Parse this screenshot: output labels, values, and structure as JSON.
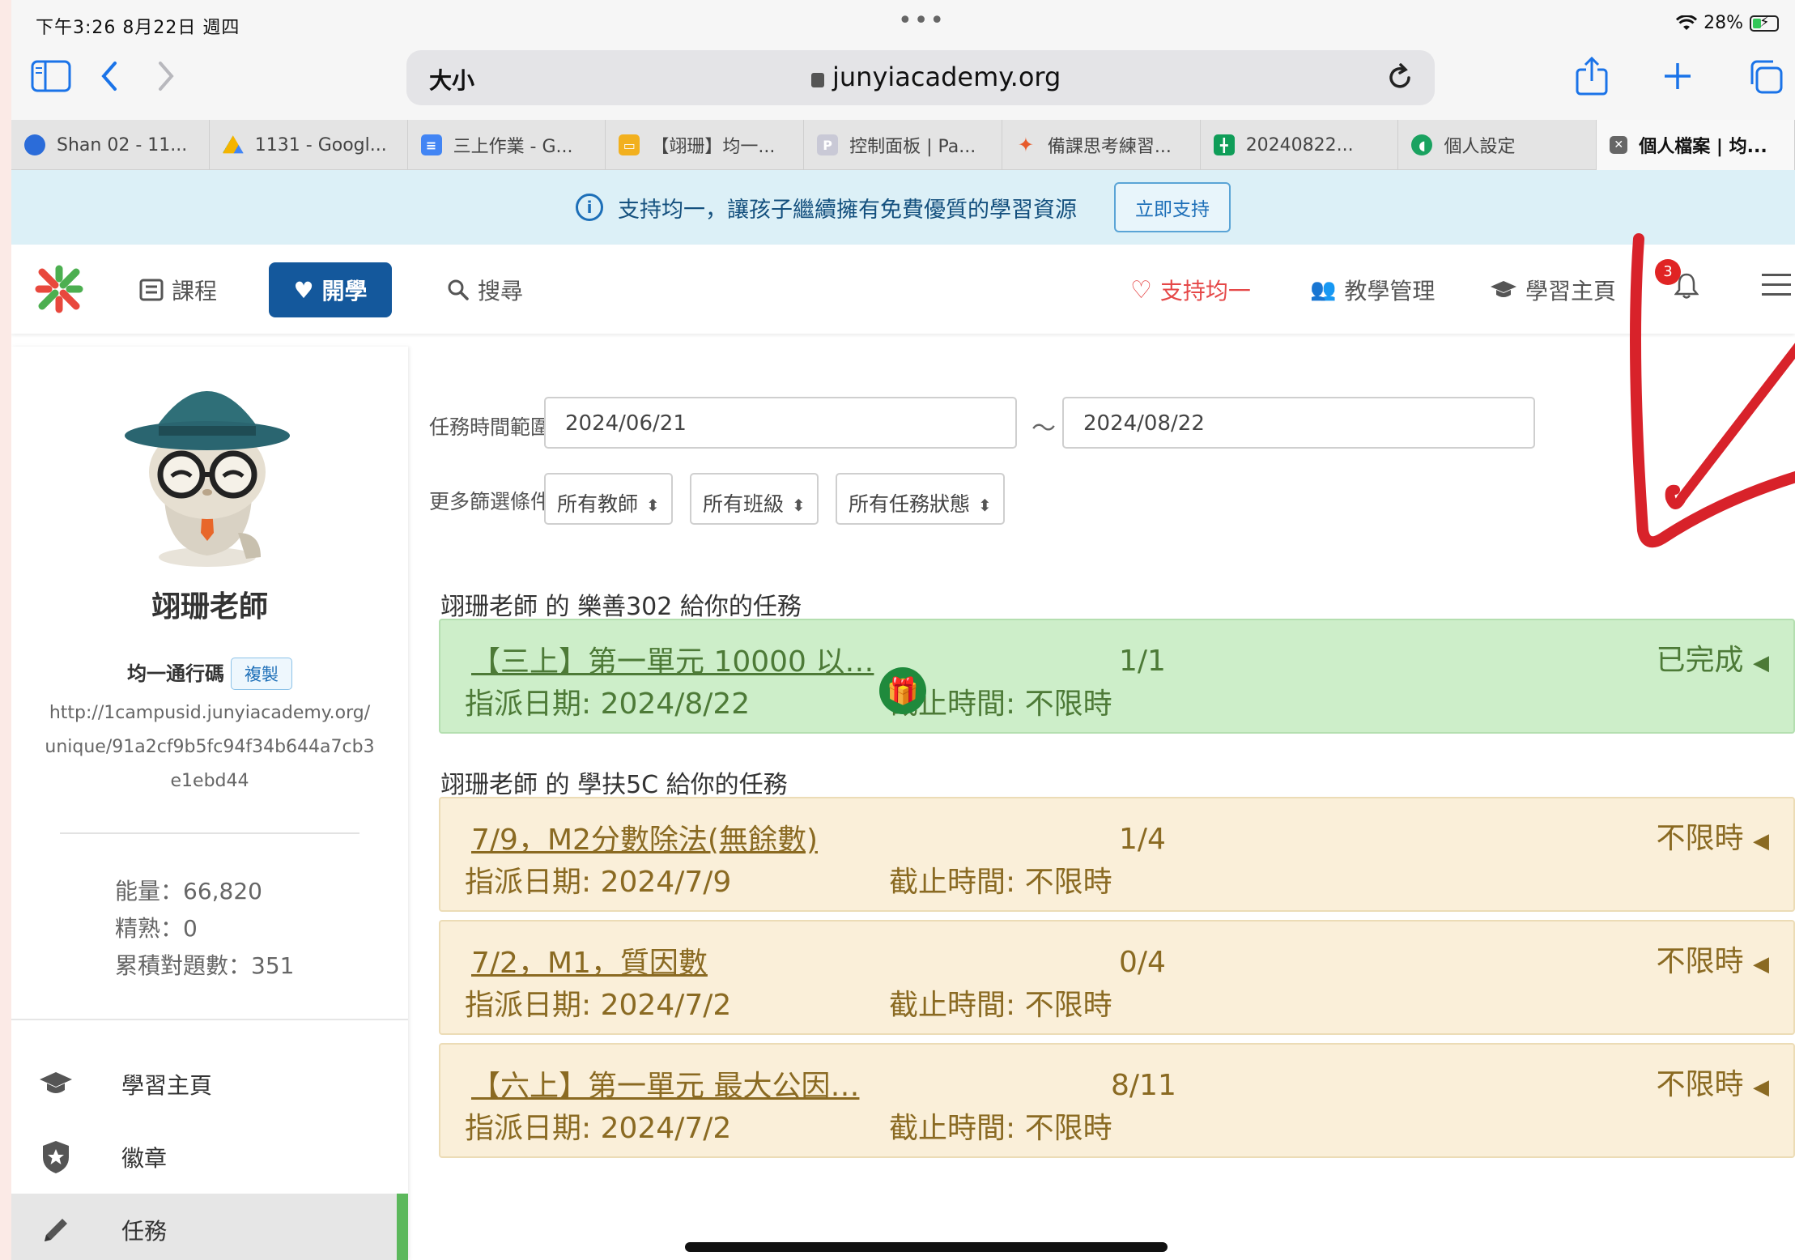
{
  "status_bar": {
    "time_date": "下午3:26   8月22日 週四",
    "dots": "•••",
    "battery": "28%"
  },
  "toolbar": {
    "text_size": "大小",
    "url": "junyiacademy.org",
    "icons": [
      "sidebar-icon",
      "back-icon",
      "forward-icon",
      "reload-icon",
      "share-icon",
      "new-tab-icon",
      "tabs-icon"
    ]
  },
  "tabs": [
    {
      "label": "Shan 02 - 11...",
      "color": "#2b6cd9",
      "icon": "chrome-profile-icon"
    },
    {
      "label": "1131 - Googl...",
      "color": "#f4b400",
      "icon": "google-drive-icon"
    },
    {
      "label": "三上作業 - G...",
      "color": "#4285f4",
      "icon": "google-docs-icon"
    },
    {
      "label": "【翊珊】均一...",
      "color": "#f2b01e",
      "icon": "google-slides-icon"
    },
    {
      "label": "控制面板 | Pa...",
      "color": "#c9c9d6",
      "icon": "padlet-icon"
    },
    {
      "label": "備課思考練習...",
      "color": "#e75a2b",
      "icon": "app-icon"
    },
    {
      "label": "20240822...",
      "color": "#0f9d58",
      "icon": "google-sheets-icon"
    },
    {
      "label": "個人設定",
      "color": "#1aa260",
      "icon": "google-classroom-icon"
    },
    {
      "label": "個人檔案 | 均...",
      "color": "#666666",
      "icon": "close-icon"
    }
  ],
  "banner": {
    "text": "支持均一，讓孩子繼續擁有免費優質的學習資源",
    "button": "立即支持"
  },
  "nav": {
    "courses": "課程",
    "start_learning": "開學",
    "search": "搜尋",
    "support": "支持均一",
    "teaching": "教學管理",
    "learning_home": "學習主頁",
    "notifications": "3"
  },
  "profile": {
    "name": "翊珊老師",
    "pass_label": "均一通行碼",
    "copy": "複製",
    "pass_url": "http://1campusid.junyiacademy.org/unique/91a2cf9b5fc94f34b644a7cb3e1ebd44",
    "energy": "能量：66,820",
    "mastery": "精熟：0",
    "correct": "累積對題數：351"
  },
  "side_menu": [
    {
      "label": "學習主頁",
      "icon": "graduation-cap-icon"
    },
    {
      "label": "徽章",
      "icon": "badge-shield-icon"
    },
    {
      "label": "任務",
      "icon": "pencil-icon",
      "active": true
    }
  ],
  "filters": {
    "range_label": "任務時間範圍：",
    "start": "2024/06/21",
    "tilde": "～",
    "end": "2024/08/22",
    "more_label": "更多篩選條件：",
    "teacher": "所有教師",
    "class": "所有班級",
    "status": "所有任務狀態"
  },
  "groups": [
    {
      "title": "翊珊老師 的 樂善302 給你的任務",
      "tasks": [
        {
          "name": "【三上】第一單元 10000 以…",
          "progress": "1/1",
          "assigned": "指派日期: 2024/8/22",
          "deadline": "截止時間: 不限時",
          "status": "已完成",
          "done": true
        }
      ]
    },
    {
      "title": "翊珊老師 的 學扶5C 給你的任務",
      "tasks": [
        {
          "name": "7/9，M2分數除法(無餘數)",
          "progress": "1/4",
          "assigned": "指派日期: 2024/7/9",
          "deadline": "截止時間: 不限時",
          "status": "不限時"
        },
        {
          "name": "7/2，M1，質因數",
          "progress": "0/4",
          "assigned": "指派日期: 2024/7/2",
          "deadline": "截止時間: 不限時",
          "status": "不限時"
        },
        {
          "name": "【六上】第一單元 最大公因…",
          "progress": "8/11",
          "assigned": "指派日期: 2024/7/2",
          "deadline": "截止時間: 不限時",
          "status": "不限時"
        }
      ]
    }
  ],
  "colors": {
    "brand_blue": "#14589c",
    "done_bg": "#cdeec9",
    "open_bg": "#faefd9",
    "annotation_red": "#d8222a"
  }
}
